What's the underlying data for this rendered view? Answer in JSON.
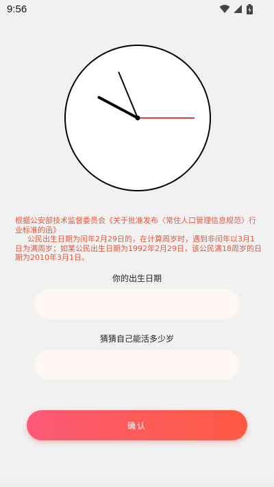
{
  "status_bar": {
    "time": "9:56",
    "icons": [
      "wifi-icon",
      "cellular-signal-icon",
      "battery-icon"
    ]
  },
  "clock": {
    "hour": 9,
    "minute": 56,
    "second": 15,
    "second_hand_color": "#e0432e"
  },
  "notice": {
    "line1": "根据公安部技术监督委员会《关于批准发布〈常住人口管理信息规范〉行业标准的函》",
    "line2": "公民出生日期为闰年2月29日的，在计算周岁时，遇到非闰年以3月1日为满周岁；如某公民出生日期为1992年2月29日，该公民满18周岁的日期为2010年3月1日。",
    "color": "#e05a3f"
  },
  "form": {
    "birth_label": "你的出生日期",
    "birth_value": "",
    "guess_label": "猜猜自己能活多少岁",
    "guess_value": ""
  },
  "confirm_button": {
    "label": "确认"
  }
}
